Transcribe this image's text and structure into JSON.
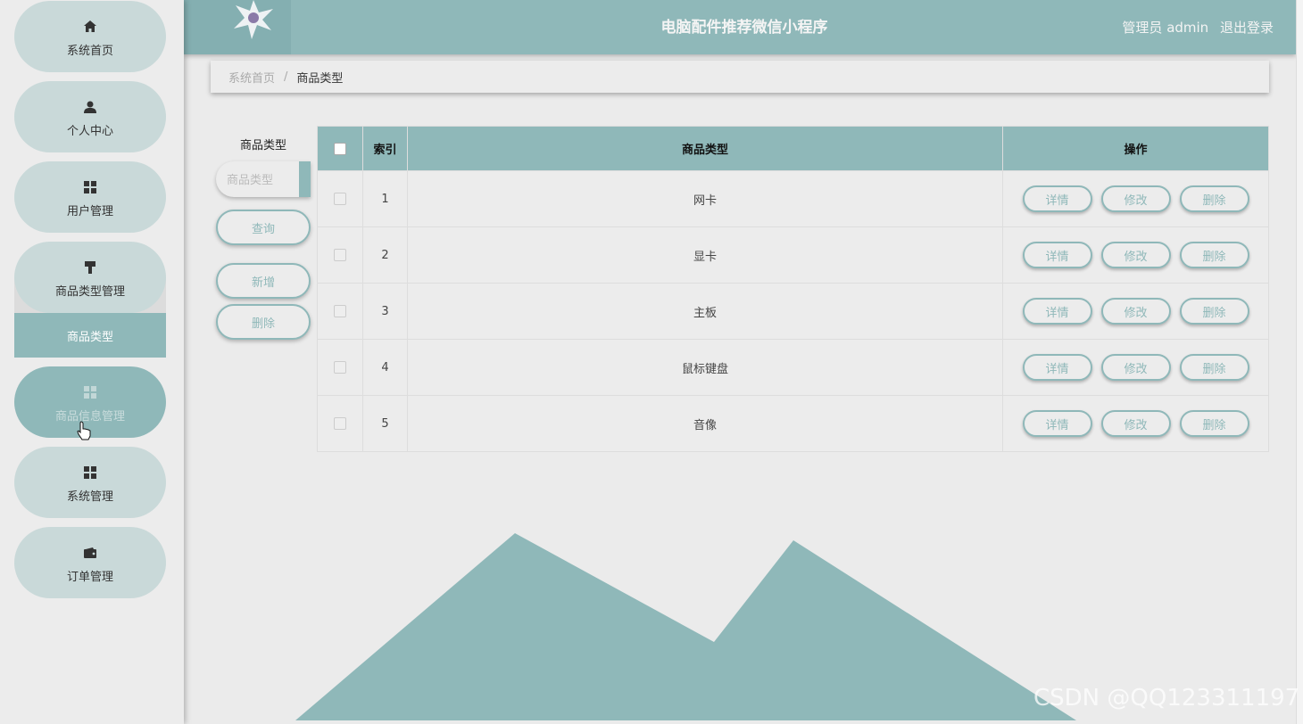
{
  "app": {
    "title": "电脑配件推荐微信小程序"
  },
  "header": {
    "user_label": "管理员 admin",
    "logout_label": "退出登录"
  },
  "sidebar": {
    "items": [
      {
        "label": "系统首页",
        "icon": "home-icon"
      },
      {
        "label": "个人中心",
        "icon": "user-icon"
      },
      {
        "label": "用户管理",
        "icon": "grid-icon"
      },
      {
        "label": "商品类型管理",
        "icon": "brush-icon"
      },
      {
        "label": "商品信息管理",
        "icon": "grid-icon"
      },
      {
        "label": "系统管理",
        "icon": "grid-icon"
      },
      {
        "label": "订单管理",
        "icon": "wallet-icon"
      }
    ],
    "submenu_label": "商品类型"
  },
  "breadcrumb": {
    "home": "系统首页",
    "separator": "/",
    "current": "商品类型"
  },
  "search": {
    "label": "商品类型",
    "placeholder": "商品类型",
    "query_label": "查询",
    "add_label": "新增",
    "delete_label": "删除"
  },
  "table": {
    "headers": {
      "index": "索引",
      "type": "商品类型",
      "actions": "操作"
    },
    "rows": [
      {
        "index": "1",
        "type": "网卡"
      },
      {
        "index": "2",
        "type": "显卡"
      },
      {
        "index": "3",
        "type": "主板"
      },
      {
        "index": "4",
        "type": "鼠标键盘"
      },
      {
        "index": "5",
        "type": "音像"
      }
    ],
    "actions": {
      "detail": "详情",
      "edit": "修改",
      "delete": "删除"
    }
  },
  "watermark": "CSDN @QQ123311197",
  "colors": {
    "accent": "#8fb8b9",
    "nav_bg": "#c9d9d9",
    "page_bg": "#ebebeb"
  }
}
